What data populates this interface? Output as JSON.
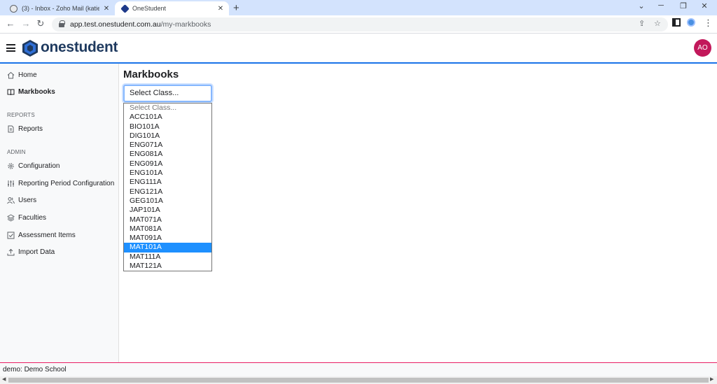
{
  "browser": {
    "tabs": [
      {
        "title": "(3) - Inbox - Zoho Mail (katie.sch",
        "active": false
      },
      {
        "title": "OneStudent",
        "active": true
      }
    ],
    "new_tab": "+",
    "window_controls": {
      "minimize": "⌄",
      "min": "─",
      "restore": "❐",
      "close": "✕"
    },
    "url_host": "app.test.onestudent.com.au",
    "url_path": "/my-markbooks"
  },
  "header": {
    "logo_text": "onestudent",
    "avatar_initials": "AO",
    "colors": {
      "avatar": "#c2185b",
      "accent": "#1a73e8",
      "logo": "#1f3a5f"
    }
  },
  "sidebar": {
    "items_top": [
      {
        "label": "Home",
        "icon": "home-icon",
        "active": false
      },
      {
        "label": "Markbooks",
        "icon": "book-icon",
        "active": true
      }
    ],
    "reports_label": "REPORTS",
    "reports_items": [
      {
        "label": "Reports",
        "icon": "document-icon"
      }
    ],
    "admin_label": "ADMIN",
    "admin_items": [
      {
        "label": "Configuration",
        "icon": "gear-icon"
      },
      {
        "label": "Reporting Period Configuration",
        "icon": "sliders-icon"
      },
      {
        "label": "Users",
        "icon": "users-icon"
      },
      {
        "label": "Faculties",
        "icon": "layers-icon"
      },
      {
        "label": "Assessment Items",
        "icon": "checkbox-icon"
      },
      {
        "label": "Import Data",
        "icon": "upload-icon"
      }
    ]
  },
  "main": {
    "title": "Markbooks",
    "select": {
      "current": "Select Class...",
      "options": [
        "Select Class...",
        "ACC101A",
        "BIO101A",
        "DIG101A",
        "ENG071A",
        "ENG081A",
        "ENG091A",
        "ENG101A",
        "ENG111A",
        "ENG121A",
        "GEG101A",
        "JAP101A",
        "MAT071A",
        "MAT081A",
        "MAT091A",
        "MAT101A",
        "MAT111A",
        "MAT121A"
      ],
      "highlighted": "MAT101A"
    }
  },
  "footer": {
    "school": "demo: Demo School"
  }
}
